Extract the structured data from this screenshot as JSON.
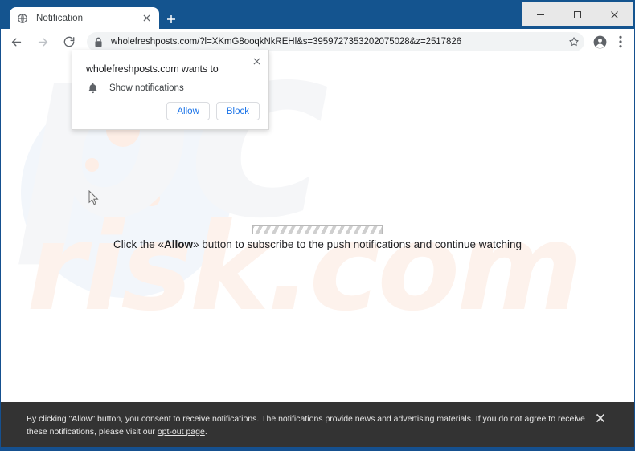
{
  "window": {
    "minimize_label": "─",
    "maximize_label": "□",
    "close_label": "✕"
  },
  "tabs": [
    {
      "title": "Notification",
      "favicon": "globe-icon",
      "close_label": "✕"
    }
  ],
  "new_tab_label": "+",
  "toolbar": {
    "back_label": "←",
    "forward_label": "→",
    "reload_label": "⟳",
    "url": "wholefreshposts.com/?l=XKmG8ooqkNkREHl&s=3959727353202075028&z=2517826",
    "lock_icon": "lock-icon",
    "star_icon": "star-icon",
    "profile_icon": "profile-avatar-icon",
    "menu_icon": "three-dot-menu-icon"
  },
  "permission_bubble": {
    "title": "wholefreshposts.com wants to",
    "permission_label": "Show notifications",
    "permission_icon": "bell-icon",
    "allow_label": "Allow",
    "block_label": "Block",
    "close_label": "✕"
  },
  "page": {
    "watermark_part1": "pc",
    "watermark_part2": "risk.com",
    "instruction_prefix": "Click the «Allow»",
    "instruction_bold": "Allow",
    "instruction_full_prefix": "Click the «",
    "instruction_full_suffix": "» button to subscribe to the push notifications and continue watching",
    "progress_label": "loading-progress-bar"
  },
  "consent_bar": {
    "line1": "By clicking \"Allow\" button, you consent to receive notifications. The notifications provide news and advertising materials. If you do not agree to receive these notifications,",
    "line2_prefix": "please visit our ",
    "link_text": "opt-out page",
    "line2_suffix": ".",
    "close_label": "✕"
  },
  "colors": {
    "window_frame": "#15508f",
    "tabstrip": "#14548f",
    "accent_blue": "#1a73e8",
    "consent_bg": "#333333",
    "watermark_blue": "#f5f6f8",
    "watermark_peach": "#fdf2ec"
  }
}
